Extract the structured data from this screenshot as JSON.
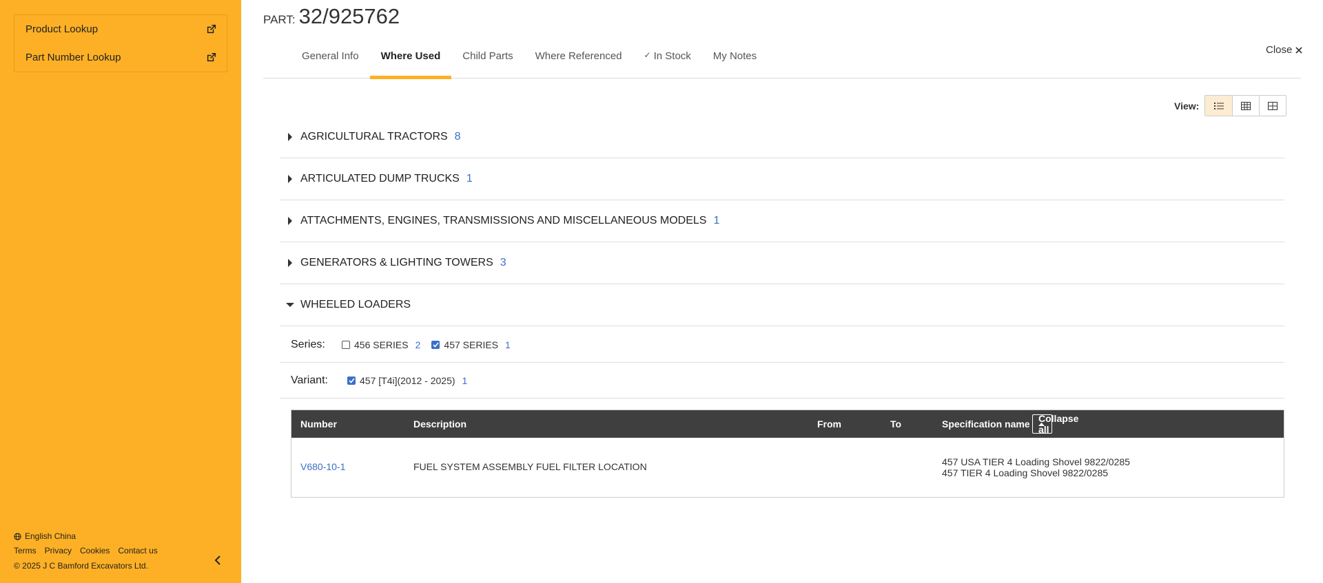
{
  "sidebar": {
    "items": [
      {
        "label": "Product Lookup",
        "icon": "external-link-icon"
      },
      {
        "label": "Part Number Lookup",
        "icon": "external-link-icon"
      }
    ],
    "footer": {
      "language": "English China",
      "links": [
        "Terms",
        "Privacy",
        "Cookies",
        "Contact us"
      ],
      "copyright": "© 2025 J C Bamford Excavators Ltd."
    }
  },
  "header": {
    "part_label": "PART:",
    "part_number": "32/925762",
    "close_label": "Close"
  },
  "tabs": [
    {
      "label": "General Info",
      "active": false
    },
    {
      "label": "Where Used",
      "active": true
    },
    {
      "label": "Child Parts",
      "active": false
    },
    {
      "label": "Where Referenced",
      "active": false
    },
    {
      "label": "In Stock",
      "active": false,
      "check": "✓"
    },
    {
      "label": "My Notes",
      "active": false
    }
  ],
  "view": {
    "label": "View:"
  },
  "categories": [
    {
      "name": "AGRICULTURAL TRACTORS",
      "count": "8",
      "expanded": false
    },
    {
      "name": "ARTICULATED DUMP TRUCKS",
      "count": "1",
      "expanded": false
    },
    {
      "name": "ATTACHMENTS, ENGINES, TRANSMISSIONS AND MISCELLANEOUS MODELS",
      "count": "1",
      "expanded": false
    },
    {
      "name": "GENERATORS & LIGHTING TOWERS",
      "count": "3",
      "expanded": false
    },
    {
      "name": "WHEELED LOADERS",
      "count": "",
      "expanded": true
    }
  ],
  "filters": {
    "series_label": "Series:",
    "series": [
      {
        "label": "456 SERIES",
        "count": "2",
        "checked": false
      },
      {
        "label": "457 SERIES",
        "count": "1",
        "checked": true
      }
    ],
    "variant_label": "Variant:",
    "variants": [
      {
        "label": "457 [T4i](2012 - 2025)",
        "count": "1",
        "checked": true
      }
    ]
  },
  "table": {
    "headers": {
      "number": "Number",
      "description": "Description",
      "from": "From",
      "to": "To",
      "spec": "Specification name"
    },
    "collapse_all": "Collapse all",
    "rows": [
      {
        "number": "V680-10-1",
        "description": "FUEL SYSTEM ASSEMBLY FUEL FILTER LOCATION",
        "from": "",
        "to": "",
        "spec": [
          "457 USA TIER 4 Loading Shovel 9822/0285",
          "457 TIER 4 Loading Shovel 9822/0285"
        ]
      }
    ]
  },
  "colors": {
    "brand": "#fdb025",
    "link": "#3a6fc7",
    "table_header": "#3f3f3f"
  }
}
